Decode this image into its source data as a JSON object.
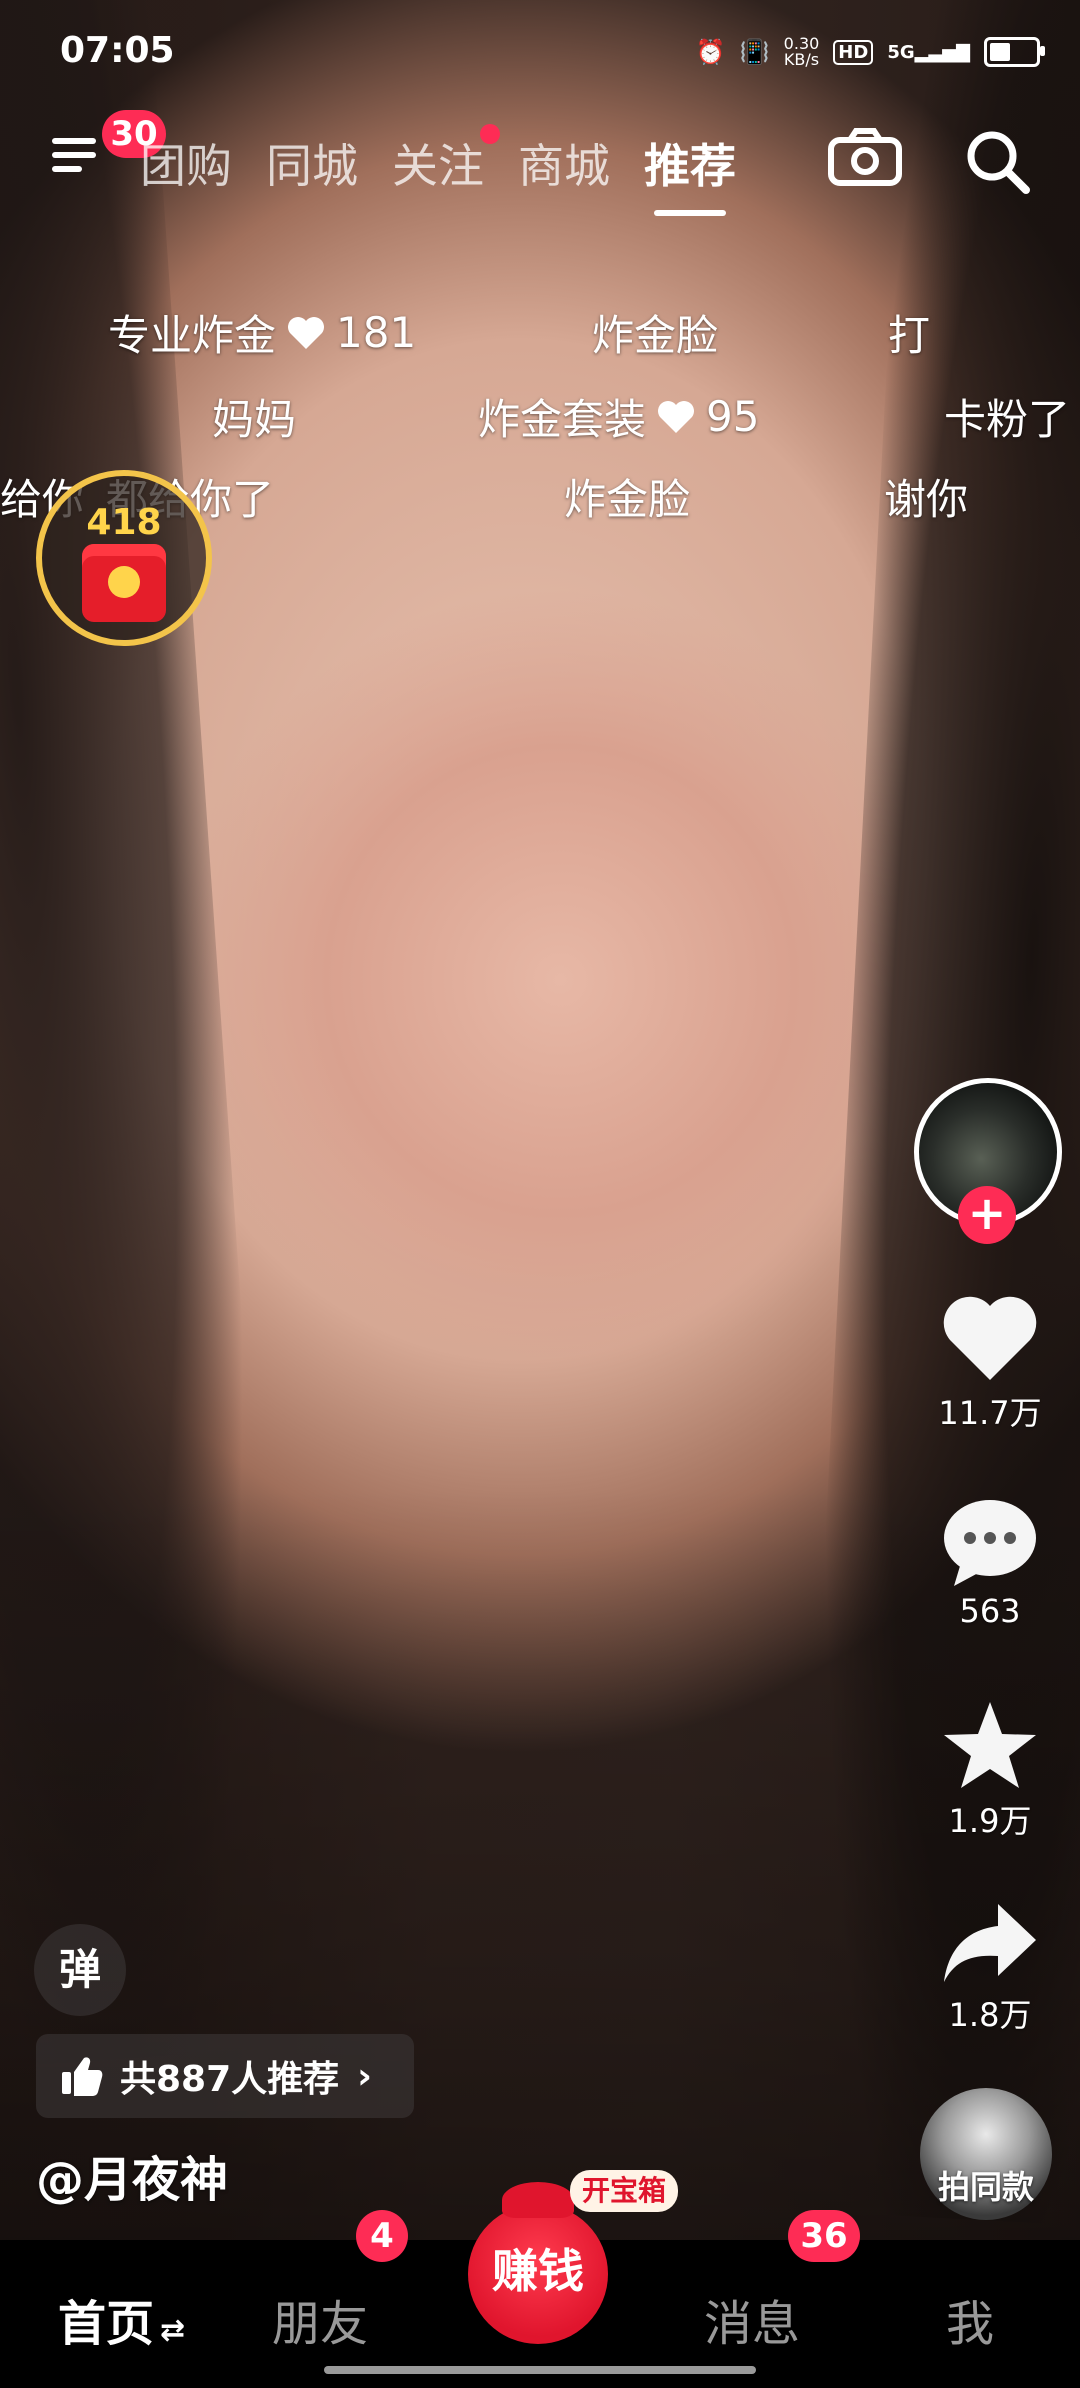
{
  "status_bar": {
    "time": "07:05",
    "net_speed": "0.30\nKB/s",
    "hd": "HD",
    "signal": "5G"
  },
  "top_nav": {
    "menu_badge": "30",
    "tabs": [
      {
        "label": "团购",
        "active": false
      },
      {
        "label": "同城",
        "active": false
      },
      {
        "label": "关注",
        "active": false,
        "dot": true
      },
      {
        "label": "商城",
        "active": false
      },
      {
        "label": "推荐",
        "active": true
      }
    ]
  },
  "danmaku": [
    {
      "text": "专业炸金",
      "likes": "181"
    },
    {
      "text": "炸金脸"
    },
    {
      "text": "打"
    },
    {
      "text": "妈妈"
    },
    {
      "text": "炸金套装",
      "likes": "95"
    },
    {
      "text": "卡粉了"
    },
    {
      "text": "给你"
    },
    {
      "text": "都给你了"
    },
    {
      "text": "炸金脸"
    },
    {
      "text": "谢你"
    }
  ],
  "red_envelope": {
    "count": "418"
  },
  "actions": {
    "likes": "11.7万",
    "comments": "563",
    "favorites": "1.9万",
    "shares": "1.8万",
    "shoot_same": "拍同款"
  },
  "danmu_toggle": "弹",
  "recommend": "共887人推荐",
  "author": "@月夜神",
  "tabbar": {
    "home": "首页",
    "friends": "朋友",
    "friends_badge": "4",
    "earn": "赚钱",
    "treasure": "开宝箱",
    "messages": "消息",
    "messages_badge": "36",
    "me": "我"
  },
  "colors": {
    "accent": "#fe2c55",
    "gold": "#f3c44a"
  }
}
